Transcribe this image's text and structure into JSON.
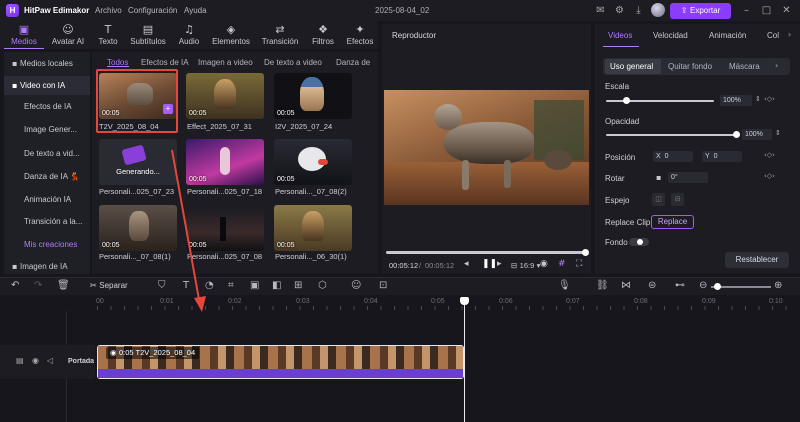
{
  "app": {
    "title": "HitPaw Edimakor",
    "menu": [
      "Archivo",
      "Configuración",
      "Ayuda"
    ],
    "project_date": "2025-08-04_02",
    "export_label": "Exportar"
  },
  "toolbar": {
    "items": [
      {
        "label": "Medios",
        "icon": "media-icon",
        "glyph": "▣"
      },
      {
        "label": "Avatar AI",
        "icon": "avatar-icon",
        "glyph": "☺"
      },
      {
        "label": "Texto",
        "icon": "text-icon",
        "glyph": "T"
      },
      {
        "label": "Subtítulos",
        "icon": "subtitles-icon",
        "glyph": "▤"
      },
      {
        "label": "Audio",
        "icon": "audio-icon",
        "glyph": "♫"
      },
      {
        "label": "Elementos",
        "icon": "elements-icon",
        "glyph": "◈"
      },
      {
        "label": "Transición",
        "icon": "transition-icon",
        "glyph": "⇄"
      },
      {
        "label": "Filtros",
        "icon": "filters-icon",
        "glyph": "❖"
      },
      {
        "label": "Efectos",
        "icon": "effects-icon",
        "glyph": "✦"
      }
    ]
  },
  "leftnav": {
    "items": [
      {
        "label": "Medios locales",
        "icon": "folder-icon"
      },
      {
        "label": "Video con IA",
        "icon": "ai-video-icon"
      },
      {
        "label": "Efectos de IA"
      },
      {
        "label": "Image Gener..."
      },
      {
        "label": "De texto a vid..."
      },
      {
        "label": "Danza de IA 💃"
      },
      {
        "label": "Animación IA"
      },
      {
        "label": "Transición a la..."
      },
      {
        "label": "Mis creaciones"
      },
      {
        "label": "Imagen de IA",
        "icon": "ai-image-icon"
      }
    ]
  },
  "media": {
    "tabs": [
      "Todos",
      "Efectos de IA",
      "Imagen a video",
      "De texto a video",
      "Danza de IA"
    ],
    "items": [
      {
        "label": "T2V_2025_08_04",
        "duration": "00:05"
      },
      {
        "label": "Effect_2025_07_31",
        "duration": "00:05"
      },
      {
        "label": "I2V_2025_07_24",
        "duration": "00:05"
      },
      {
        "label": "Personali...025_07_23",
        "duration": "",
        "status": "Generando..."
      },
      {
        "label": "Personali...025_07_18",
        "duration": "00:05"
      },
      {
        "label": "Personali..._07_08(2)",
        "duration": "00:05"
      },
      {
        "label": "Personali..._07_08(1)",
        "duration": "00:05"
      },
      {
        "label": "Personali...025_07_08",
        "duration": "00:05"
      },
      {
        "label": "Personali..._06_30(1)",
        "duration": "00:05"
      }
    ]
  },
  "player": {
    "title": "Reproductor",
    "current_time": "00:05:12",
    "total_time": "00:05:12",
    "ratio": "16:9",
    "progress": 1.0
  },
  "inspector": {
    "tabs": [
      "Videos",
      "Velocidad",
      "Animación",
      "Col"
    ],
    "subtabs": [
      "Uso general",
      "Quitar fondo",
      "Máscara"
    ],
    "scale": {
      "label": "Escala",
      "value": "100%",
      "level": 0.1
    },
    "opacity": {
      "label": "Opacidad",
      "value": "100%",
      "level": 1.0
    },
    "position": {
      "label": "Posición",
      "x_label": "X",
      "x": "0",
      "y_label": "Y",
      "y": "0"
    },
    "rotate": {
      "label": "Rotar",
      "value": "0°"
    },
    "mirror": {
      "label": "Espejo"
    },
    "replace": {
      "label": "Replace Clip",
      "button": "Replace"
    },
    "background": {
      "label": "Fondo"
    },
    "reset": "Restablecer"
  },
  "timeline": {
    "split_label": "Separar",
    "ruler": [
      "00",
      "0:01",
      "0:02",
      "0:03",
      "0:04",
      "0:05",
      "0:06",
      "0:07",
      "0:08",
      "0:09",
      "0:10"
    ],
    "track_label": "Portada",
    "clip": {
      "duration": "0:05",
      "name": "T2V_2025_08_04"
    }
  },
  "colors": {
    "accent": "#8b3dff",
    "accent_text": "#b07bff",
    "annotation_arrow": "#e5473a"
  }
}
